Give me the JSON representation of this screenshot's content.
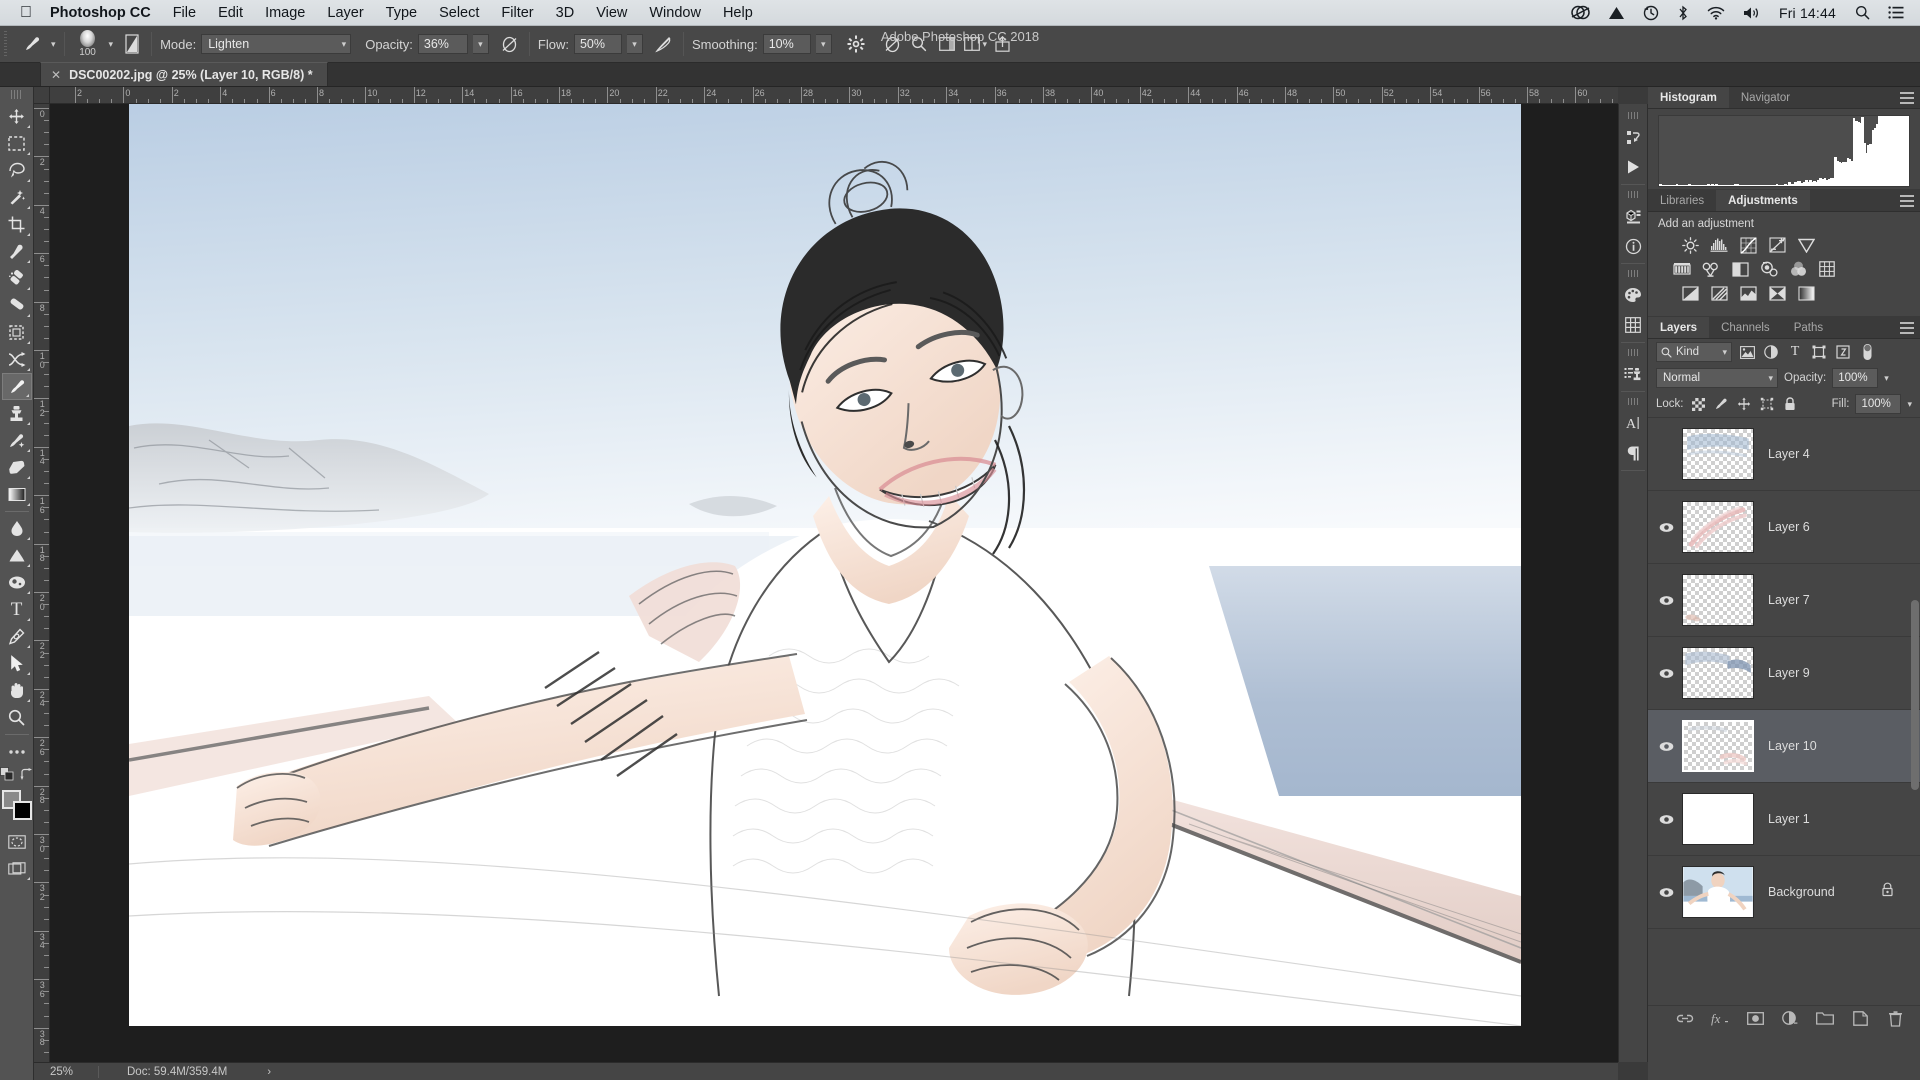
{
  "menubar": {
    "apple_icon": "apple-icon",
    "app_name": "Photoshop CC",
    "items": [
      "File",
      "Edit",
      "Image",
      "Layer",
      "Type",
      "Select",
      "Filter",
      "3D",
      "View",
      "Window",
      "Help"
    ],
    "status_icons": [
      "creative-cloud-icon",
      "dropbox-icon",
      "time-machine-icon",
      "bluetooth-icon",
      "wifi-icon",
      "volume-icon"
    ],
    "clock": "Fri 14:44",
    "search_icon": "spotlight-search-icon",
    "control_center_icon": "control-center-icon"
  },
  "window": {
    "title": "Adobe Photoshop CC 2018",
    "traffic_lights": [
      "close-button",
      "minimize-button",
      "zoom-button"
    ]
  },
  "options_bar": {
    "tool_icon": "brush-tool-icon",
    "brush_size": "100",
    "brush_preset_icon": "brush-preset-picker-icon",
    "brush_panel_icon": "brush-settings-panel-icon",
    "mode_label": "Mode:",
    "mode_value": "Lighten",
    "opacity_label": "Opacity:",
    "opacity_value": "36%",
    "opacity_pressure_icon": "tablet-pressure-opacity-icon",
    "flow_label": "Flow:",
    "flow_value": "50%",
    "airbrush_icon": "airbrush-icon",
    "smoothing_label": "Smoothing:",
    "smoothing_value": "10%",
    "smoothing_options_icon": "smoothing-options-gear-icon",
    "tablet_pressure_icon": "tablet-pressure-size-icon",
    "search_icon": "search-icon",
    "workspace_icon": "workspace-switcher-icon",
    "arrange_icon": "arrange-documents-icon",
    "share_icon": "share-icon"
  },
  "document_tab": {
    "close_icon": "close-tab-icon",
    "title": "DSC00202.jpg @ 25% (Layer 10, RGB/8) *"
  },
  "tools": [
    {
      "name": "move-tool",
      "glyph": "move"
    },
    {
      "name": "rectangular-marquee-tool",
      "glyph": "marquee"
    },
    {
      "name": "lasso-tool",
      "glyph": "lasso"
    },
    {
      "name": "magic-wand-tool",
      "glyph": "wand"
    },
    {
      "name": "crop-tool",
      "glyph": "crop"
    },
    {
      "name": "eyedropper-tool",
      "glyph": "eyedropper"
    },
    {
      "name": "spot-healing-brush-tool",
      "glyph": "healing"
    },
    {
      "name": "patch-tool",
      "glyph": "patch"
    },
    {
      "name": "frame-tool",
      "glyph": "frame"
    },
    {
      "name": "shuffle-tool",
      "glyph": "shuffle"
    },
    {
      "name": "brush-tool",
      "glyph": "brush",
      "selected": true
    },
    {
      "name": "clone-stamp-tool",
      "glyph": "stamp"
    },
    {
      "name": "history-brush-tool",
      "glyph": "historybrush"
    },
    {
      "name": "eraser-tool",
      "glyph": "eraser"
    },
    {
      "name": "gradient-tool",
      "glyph": "gradient"
    },
    {
      "name": "blur-tool",
      "glyph": "blur"
    },
    {
      "name": "dodge-tool",
      "glyph": "dodge"
    },
    {
      "name": "sponge-tool",
      "glyph": "sponge"
    },
    {
      "name": "type-tool",
      "glyph": "type"
    },
    {
      "name": "pen-tool",
      "glyph": "pen"
    },
    {
      "name": "path-selection-tool",
      "glyph": "pathselect"
    },
    {
      "name": "hand-tool",
      "glyph": "hand"
    },
    {
      "name": "zoom-tool",
      "glyph": "zoom"
    },
    {
      "name": "edit-toolbar-tool",
      "glyph": "ellipsis"
    }
  ],
  "tool_footer": {
    "default_colors_icon": "default-colors-icon",
    "swap_colors_icon": "swap-colors-icon",
    "foreground_color": "#8a8a8a",
    "background_color": "#000000",
    "quick_mask_icon": "quick-mask-mode-icon",
    "screen_mode_icon": "screen-mode-icon"
  },
  "rulers": {
    "unit": "in",
    "horizontal_labels": [
      "2",
      "0",
      "2",
      "4",
      "6",
      "8",
      "10",
      "12",
      "14",
      "16",
      "18",
      "20",
      "22",
      "24",
      "26",
      "28",
      "30",
      "32",
      "34",
      "36",
      "38",
      "40",
      "42",
      "44",
      "46",
      "48",
      "50",
      "52",
      "54",
      "56",
      "58",
      "60"
    ],
    "vertical_labels": [
      "0",
      "2",
      "4",
      "6",
      "8",
      "10",
      "12",
      "14",
      "16",
      "18",
      "20",
      "22",
      "24",
      "26",
      "28",
      "30",
      "32",
      "34",
      "36",
      "38"
    ]
  },
  "status_bar": {
    "zoom": "25%",
    "doc_info": "Doc: 59.4M/359.4M",
    "arrow_icon": "status-expand-arrow-icon"
  },
  "icon_dock": [
    {
      "name": "actions-panel-icon"
    },
    {
      "name": "play-icon"
    },
    {
      "name": "3d-panel-icon"
    },
    {
      "name": "info-panel-icon"
    },
    {
      "name": "color-swatches-panel-icon"
    },
    {
      "name": "patterns-grid-panel-icon"
    },
    {
      "name": "clone-source-panel-icon"
    },
    {
      "name": "character-panel-icon"
    },
    {
      "name": "paragraph-panel-icon"
    }
  ],
  "histogram_panel": {
    "tabs": [
      {
        "label": "Histogram",
        "active": true
      },
      {
        "label": "Navigator",
        "active": false
      }
    ],
    "menu_icon": "panel-menu-icon",
    "warning_icon": "cached-data-warning-icon"
  },
  "adjustments_panel": {
    "tabs": [
      {
        "label": "Libraries",
        "active": false
      },
      {
        "label": "Adjustments",
        "active": true
      }
    ],
    "menu_icon": "panel-menu-icon",
    "title": "Add an adjustment",
    "rows": [
      [
        "brightness-contrast-icon",
        "levels-icon",
        "curves-icon",
        "exposure-icon",
        "vibrance-icon"
      ],
      [
        "hue-saturation-icon",
        "color-balance-icon",
        "black-white-icon",
        "photo-filter-icon",
        "channel-mixer-icon",
        "color-lookup-icon"
      ],
      [
        "invert-icon",
        "posterize-icon",
        "threshold-icon",
        "selective-color-icon",
        "gradient-map-icon"
      ]
    ]
  },
  "layers_panel": {
    "tabs": [
      {
        "label": "Layers",
        "active": true
      },
      {
        "label": "Channels",
        "active": false
      },
      {
        "label": "Paths",
        "active": false
      }
    ],
    "menu_icon": "panel-menu-icon",
    "filter": {
      "search_icon": "filter-search-icon",
      "kind_label": "Kind",
      "filter_icons": [
        "filter-pixel-icon",
        "filter-adjustment-icon",
        "filter-type-icon",
        "filter-shape-icon",
        "filter-smart-object-icon"
      ],
      "toggle_icon": "filter-toggle-icon"
    },
    "blend_mode": "Normal",
    "opacity_label": "Opacity:",
    "opacity_value": "100%",
    "lock_label": "Lock:",
    "lock_icons": [
      "lock-transparent-pixels-icon",
      "lock-image-pixels-icon",
      "lock-position-icon",
      "lock-artboard-nesting-icon",
      "lock-all-icon"
    ],
    "fill_label": "Fill:",
    "fill_value": "100%",
    "layers": [
      {
        "name": "Layer 4",
        "visible": false,
        "selected": false,
        "locked": false,
        "thumb": "bluish-strokes"
      },
      {
        "name": "Layer 6",
        "visible": true,
        "selected": false,
        "locked": false,
        "thumb": "pink-strokes"
      },
      {
        "name": "Layer 7",
        "visible": true,
        "selected": false,
        "locked": false,
        "thumb": "faint-pink-corner"
      },
      {
        "name": "Layer 9",
        "visible": true,
        "selected": false,
        "locked": false,
        "thumb": "blue-gray-strokes"
      },
      {
        "name": "Layer 10",
        "visible": true,
        "selected": true,
        "locked": false,
        "thumb": "light-pink-strokes"
      },
      {
        "name": "Layer 1",
        "visible": true,
        "selected": false,
        "locked": false,
        "thumb": "solid-white"
      },
      {
        "name": "Background",
        "visible": true,
        "selected": false,
        "locked": true,
        "thumb": "photo-woman-seaside"
      }
    ],
    "footer_icons": [
      "link-layers-icon",
      "layer-style-fx-icon",
      "add-layer-mask-icon",
      "new-adjustment-layer-icon",
      "new-group-icon",
      "new-layer-icon",
      "delete-layer-icon"
    ]
  },
  "canvas": {
    "description": "Sketch-filtered portrait of a smiling woman in a white dress reclining on a white boat deck, blue sea and sky behind, rocky headland at left",
    "colors": {
      "sky": "#cfdced",
      "sea": "#9fb3cb",
      "skin": "#f5ddd0",
      "hair": "#2b2b2b",
      "deck": "#ffffff",
      "rail": "#ecdcd8"
    }
  }
}
